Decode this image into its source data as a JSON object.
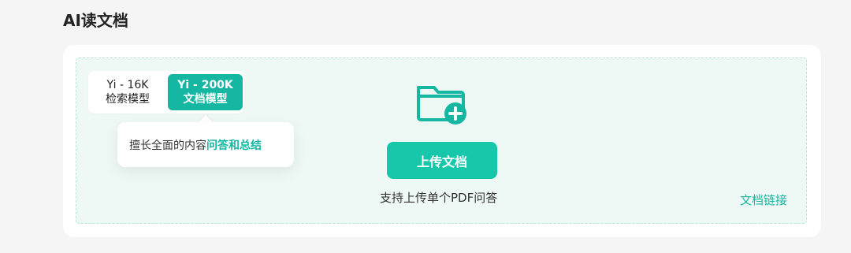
{
  "section": {
    "title": "AI读文档"
  },
  "model_switch": {
    "left": {
      "line1": "Yi - 16K",
      "line2": "检索模型"
    },
    "right": {
      "line1": "Yi - 200K",
      "line2": "文档模型"
    }
  },
  "tooltip": {
    "prefix": "擅长全面的内容",
    "highlight": "问答和总结"
  },
  "upload": {
    "icon": "folder-plus-icon",
    "button_label": "上传文档",
    "hint": "支持上传单个PDF问答",
    "link_label": "文档链接"
  },
  "colors": {
    "accent": "#16b7a2",
    "button": "#17c7aa",
    "dropzone_bg": "#eef8f4",
    "page_bg": "#f5f5f5"
  }
}
